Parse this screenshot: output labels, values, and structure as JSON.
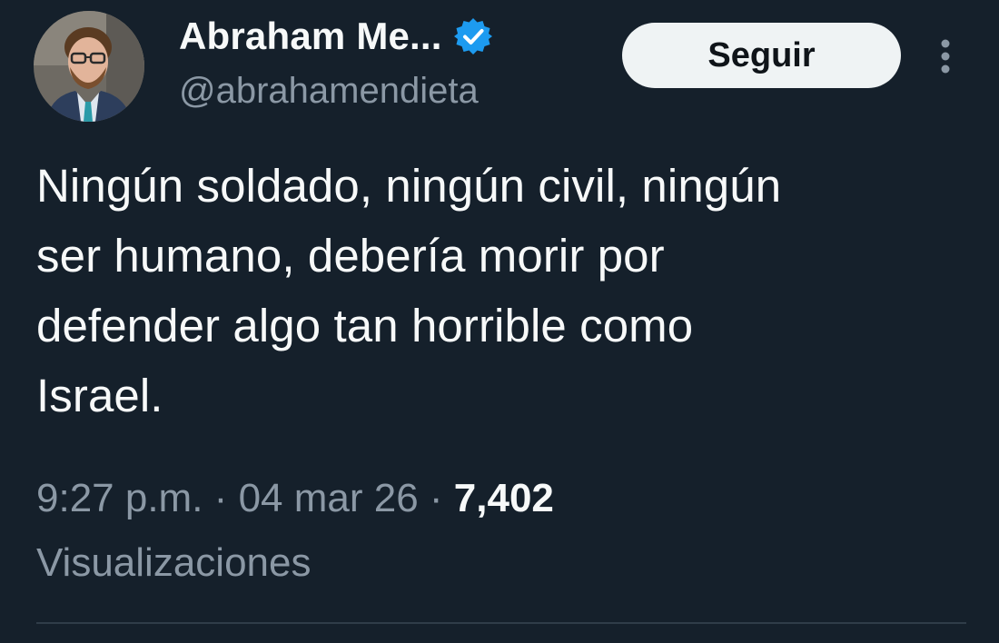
{
  "user": {
    "display_name": "Abraham Me...",
    "handle": "@abrahamendieta",
    "verified": true
  },
  "actions": {
    "follow_label": "Seguir",
    "more_icon": "more-vertical-icon"
  },
  "tweet": {
    "text": "Ningún soldado, ningún civil, ningún\nser humano, debería morir por\ndefender algo tan horrible como\nIsrael.",
    "time": "9:27 p.m.",
    "date": "04 mar 26",
    "separator": "·",
    "views_count": "7,402",
    "views_label": "Visualizaciones"
  },
  "colors": {
    "background": "#15202b",
    "text_primary": "#f7f9f9",
    "text_secondary": "#8b98a5",
    "verified_blue": "#1d9bf0",
    "button_bg": "#eff3f4"
  }
}
